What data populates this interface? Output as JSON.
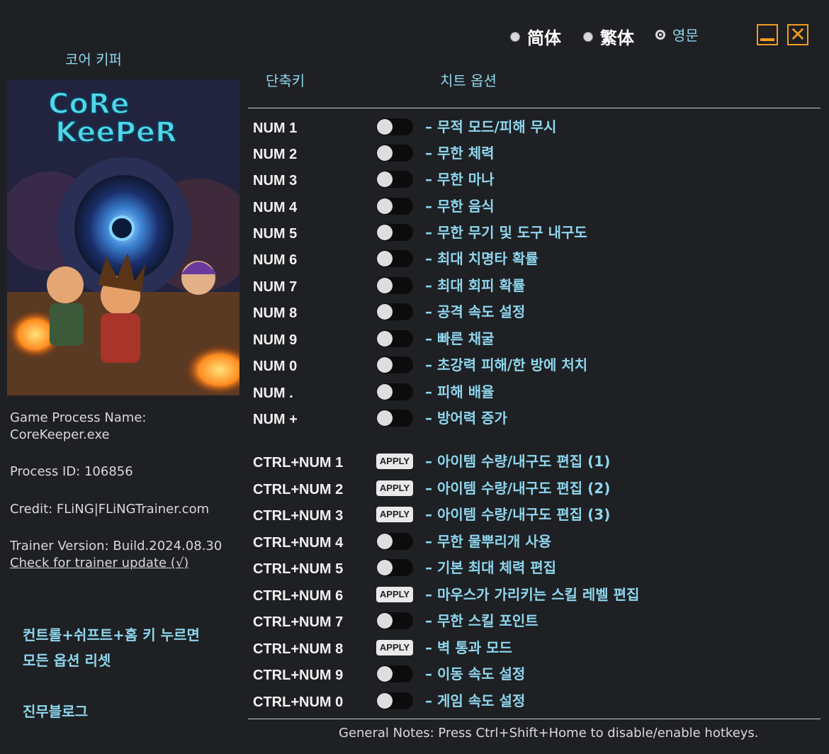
{
  "languages": [
    {
      "label": "简体",
      "selected": false
    },
    {
      "label": "繁体",
      "selected": false
    },
    {
      "label": "영문",
      "selected": true
    }
  ],
  "window": {
    "minimize_icon": "minimize-icon",
    "close_icon": "close-icon",
    "close_glyph": "✕"
  },
  "game": {
    "title": "코어 키퍼",
    "cover_logo_line1": "CoRe",
    "cover_logo_line2": "KeePeR",
    "process_name_label": "Game Process Name:",
    "process_name": "CoreKeeper.exe",
    "process_id": "Process ID: 106856",
    "credit": "Credit: FLiNG|FLiNGTrainer.com",
    "trainer_version": "Trainer Version: Build.2024.08.30",
    "update_link": "Check for trainer update (√)"
  },
  "reset_note": "컨트롤+쉬프트+홈 키 누르면 모든 옵션 리셋",
  "blog_link": "진무블로그",
  "headers": {
    "hotkey": "단축키",
    "options": "치트 옵션"
  },
  "cheats": [
    {
      "key": "NUM 1",
      "control": "toggle",
      "label": "– 무적 모드/피해 무시"
    },
    {
      "key": "NUM 2",
      "control": "toggle",
      "label": "– 무한 체력"
    },
    {
      "key": "NUM 3",
      "control": "toggle",
      "label": "– 무한 마나"
    },
    {
      "key": "NUM 4",
      "control": "toggle",
      "label": "– 무한 음식"
    },
    {
      "key": "NUM 5",
      "control": "toggle",
      "label": "– 무한 무기 및 도구 내구도"
    },
    {
      "key": "NUM 6",
      "control": "toggle",
      "label": "– 최대 치명타 확률"
    },
    {
      "key": "NUM 7",
      "control": "toggle",
      "label": "– 최대 회피 확률"
    },
    {
      "key": "NUM 8",
      "control": "toggle",
      "label": "– 공격 속도 설정"
    },
    {
      "key": "NUM 9",
      "control": "toggle",
      "label": "– 빠른 채굴"
    },
    {
      "key": "NUM 0",
      "control": "toggle",
      "label": "– 초강력 피해/한 방에 처치"
    },
    {
      "key": "NUM .",
      "control": "toggle",
      "label": "– 피해 배율"
    },
    {
      "key": "NUM +",
      "control": "toggle",
      "label": "– 방어력 증가"
    },
    {
      "key": "CTRL+NUM 1",
      "control": "apply",
      "label": "– 아이템 수량/내구도 편집 (1)"
    },
    {
      "key": "CTRL+NUM 2",
      "control": "apply",
      "label": "– 아이템 수량/내구도 편집 (2)"
    },
    {
      "key": "CTRL+NUM 3",
      "control": "apply",
      "label": "– 아이템 수량/내구도 편집 (3)"
    },
    {
      "key": "CTRL+NUM 4",
      "control": "toggle",
      "label": "– 무한 물뿌리개 사용"
    },
    {
      "key": "CTRL+NUM 5",
      "control": "toggle",
      "label": "– 기본 최대 체력 편집"
    },
    {
      "key": "CTRL+NUM 6",
      "control": "apply",
      "label": "– 마우스가 가리키는 스킬 레벨 편집"
    },
    {
      "key": "CTRL+NUM 7",
      "control": "toggle",
      "label": "– 무한 스킬 포인트"
    },
    {
      "key": "CTRL+NUM 8",
      "control": "apply",
      "label": "– 벽 통과 모드"
    },
    {
      "key": "CTRL+NUM 9",
      "control": "toggle",
      "label": "– 이동 속도 설정"
    },
    {
      "key": "CTRL+NUM 0",
      "control": "toggle",
      "label": "– 게임 속도 설정"
    }
  ],
  "apply_label": "APPLY",
  "footer_note": "General Notes: Press Ctrl+Shift+Home to disable/enable hotkeys.",
  "colors": {
    "accent": "#8fd6ee",
    "window_buttons": "#f39c1e",
    "background": "#1e2023"
  }
}
